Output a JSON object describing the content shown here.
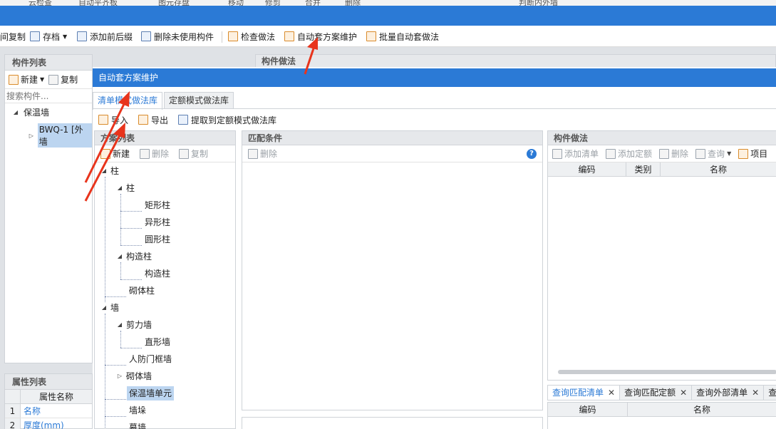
{
  "ribbon_top": {
    "items": [
      "云检查",
      "自动平齐板",
      "图元存盘",
      "移动",
      "修剪",
      "合并",
      "删除",
      "判断内外墙"
    ]
  },
  "toolbar": {
    "items": [
      {
        "label": "间复制"
      },
      {
        "label": "存档"
      },
      {
        "label": "添加前后缀"
      },
      {
        "label": "删除未使用构件"
      },
      {
        "label": "检查做法"
      },
      {
        "label": "自动套方案维护"
      },
      {
        "label": "批量自动套做法"
      }
    ]
  },
  "left_panel": {
    "title": "构件列表",
    "new_label": "新建",
    "copy_label": "复制",
    "search_placeholder": "搜索构件...",
    "tree": {
      "root": "保温墙",
      "child": "BWQ-1 [外墙"
    }
  },
  "middle_panel_title": "构件做法",
  "properties": {
    "title": "属性列表",
    "col_name": "属性名称",
    "rows": [
      {
        "num": "1",
        "name": "名称"
      },
      {
        "num": "2",
        "name": "厚度(mm)"
      }
    ]
  },
  "dialog": {
    "title": "自动套方案维护",
    "tabs": [
      "清单模式做法库",
      "定额模式做法库"
    ],
    "toolbar": {
      "import": "导入",
      "export": "导出",
      "extract": "提取到定额模式做法库"
    },
    "scheme_list": {
      "title": "方案列表",
      "new": "新建",
      "delete": "删除",
      "copy": "复制",
      "tree": {
        "n1": "柱",
        "n1a": "柱",
        "n1a1": "矩形柱",
        "n1a2": "异形柱",
        "n1a3": "圆形柱",
        "n1b": "构造柱",
        "n1b1": "构造柱",
        "n1c": "砌体柱",
        "n2": "墙",
        "n2a": "剪力墙",
        "n2a1": "直形墙",
        "n2b": "人防门框墙",
        "n2c": "砌体墙",
        "n2d": "保温墙单元",
        "n2e": "墙垛",
        "n2f": "幕墙"
      }
    },
    "match": {
      "title": "匹配条件",
      "delete": "删除"
    },
    "method": {
      "title": "构件做法",
      "add_list": "添加清单",
      "add_quota": "添加定额",
      "delete": "删除",
      "query": "查询",
      "item": "项目",
      "col_code": "编码",
      "col_type": "类别",
      "col_name": "名称"
    },
    "bottom_tabs": [
      "查询匹配清单",
      "查询匹配定额",
      "查询外部清单",
      "查"
    ],
    "bottom_grid": {
      "col_code": "编码",
      "col_name": "名称"
    }
  },
  "colors": {
    "accent": "#2b7ad6",
    "arrow": "#e8341c"
  }
}
